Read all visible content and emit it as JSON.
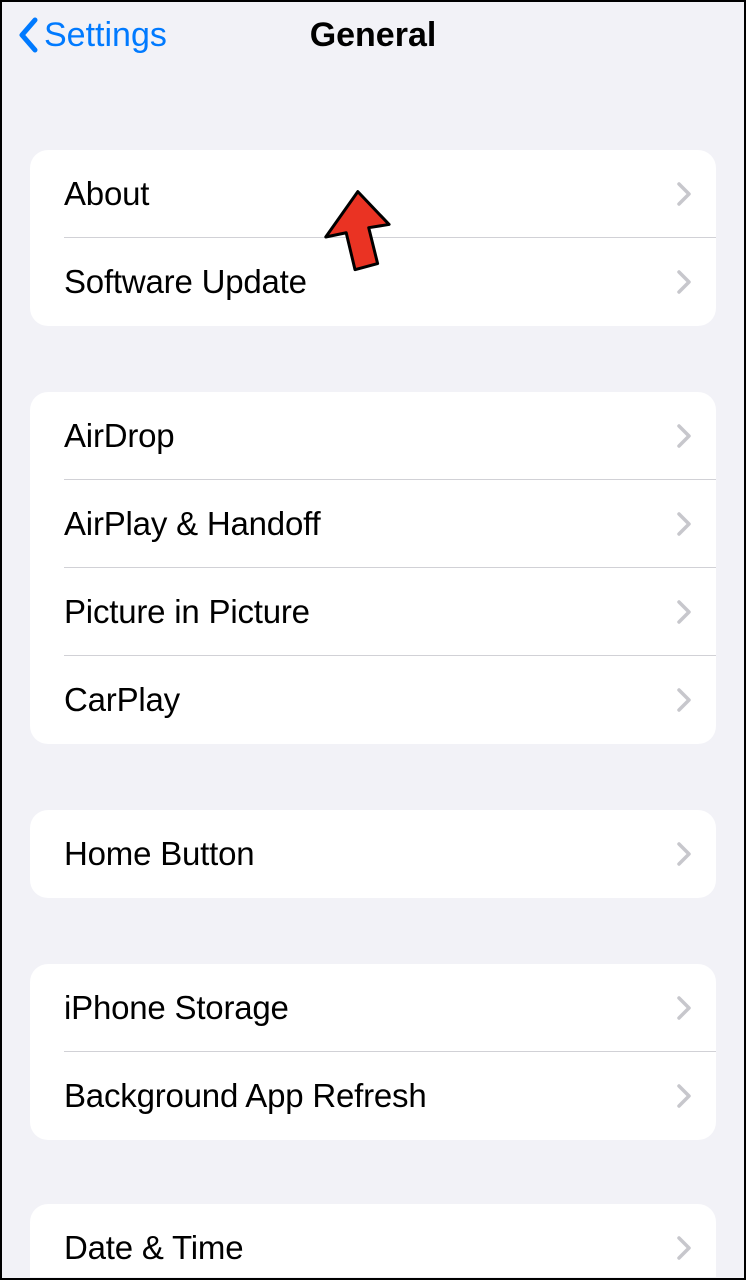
{
  "header": {
    "back_label": "Settings",
    "title": "General"
  },
  "groups": [
    {
      "items": [
        {
          "label": "About"
        },
        {
          "label": "Software Update"
        }
      ]
    },
    {
      "items": [
        {
          "label": "AirDrop"
        },
        {
          "label": "AirPlay & Handoff"
        },
        {
          "label": "Picture in Picture"
        },
        {
          "label": "CarPlay"
        }
      ]
    },
    {
      "items": [
        {
          "label": "Home Button"
        }
      ]
    },
    {
      "items": [
        {
          "label": "iPhone Storage"
        },
        {
          "label": "Background App Refresh"
        }
      ]
    },
    {
      "items": [
        {
          "label": "Date & Time"
        }
      ]
    }
  ]
}
